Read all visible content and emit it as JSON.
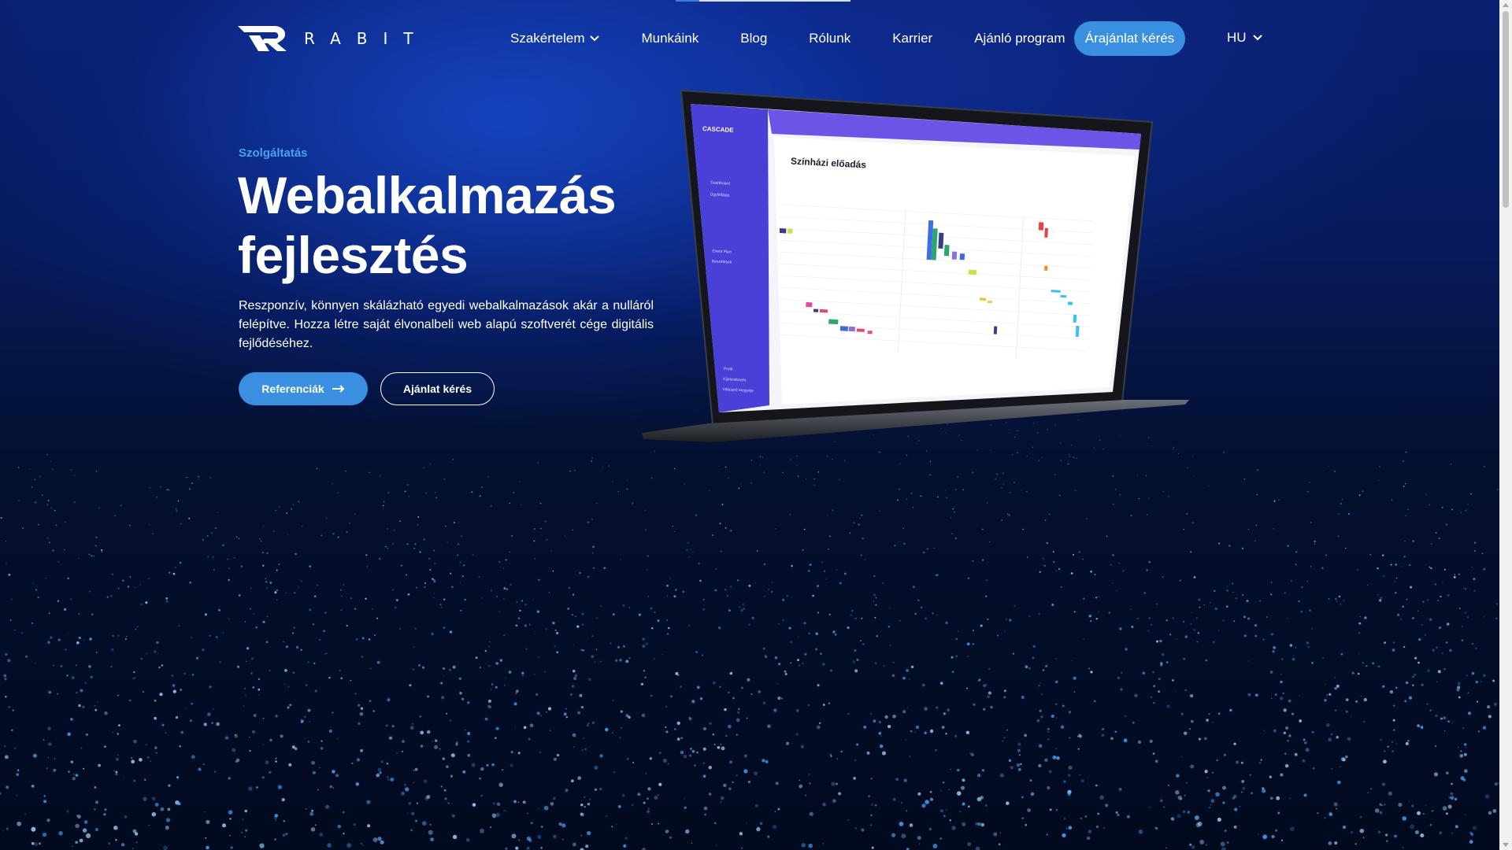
{
  "brand": {
    "name": "RABIT"
  },
  "nav": {
    "items": [
      {
        "label": "Szakértelem",
        "has_dropdown": true
      },
      {
        "label": "Munkáink"
      },
      {
        "label": "Blog"
      },
      {
        "label": "Rólunk"
      },
      {
        "label": "Karrier"
      },
      {
        "label": "Ajánló program"
      }
    ],
    "cta_label": "Árajánlat kérés",
    "language": "HU"
  },
  "hero": {
    "eyebrow": "Szolgáltatás",
    "title_line1": "Webalkalmazás",
    "title_line2": "fejlesztés",
    "description": "Reszponzív, könnyen skálázható egyedi webalkalmazások akár a nulláról felépítve. Hozza létre saját élvonalbeli web alapú szoftverét cége digitális fejlődéséhez.",
    "primary_button": "Referenciák",
    "secondary_button": "Ajánlat kérés"
  },
  "mockup": {
    "app_name": "CASCADE",
    "page_title": "Színházi előadás",
    "sidebar_items": [
      "Dashboard",
      "Ügyféllátás",
      "Event Plan",
      "Beszélések"
    ],
    "bottom_items": [
      "Profil",
      "Kijelentkezés",
      "Választó megyéje"
    ]
  },
  "colors": {
    "accent": "#3b8fe0",
    "eyebrow": "#4aa1ee",
    "mockup_sidebar": "#4a3fd6"
  },
  "icons": [
    "rabit-logo-icon",
    "chevron-down-icon",
    "arrow-right-icon"
  ]
}
